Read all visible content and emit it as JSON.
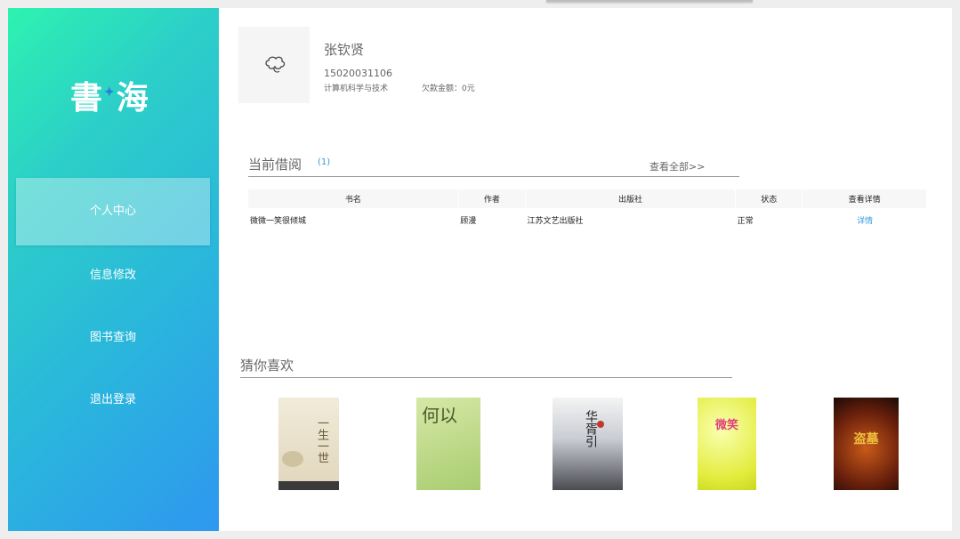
{
  "app": {
    "logo_chars": [
      "書",
      "海"
    ]
  },
  "sidebar": {
    "items": [
      {
        "label": "个人中心",
        "active": true
      },
      {
        "label": "信息修改",
        "active": false
      },
      {
        "label": "图书查询",
        "active": false
      },
      {
        "label": "退出登录",
        "active": false
      }
    ]
  },
  "profile": {
    "name": "张钦贤",
    "student_id": "15020031106",
    "major": "计算机科学与技术",
    "debt": "欠款金额：0元",
    "avatar_icon": "cloud-doodle-icon"
  },
  "borrow": {
    "title": "当前借阅",
    "count": "(1)",
    "view_all": "查看全部>>",
    "columns": [
      "书名",
      "作者",
      "出版社",
      "状态",
      "查看详情"
    ],
    "rows": [
      {
        "title": "微微一笑很倾城",
        "author": "顾漫",
        "publisher": "江苏文艺出版社",
        "status": "正常",
        "detail": "详情"
      }
    ]
  },
  "recommend": {
    "title": "猜你喜欢",
    "books": [
      {
        "cover_title": "一生一世",
        "cover_color": "#e8e0cc"
      },
      {
        "cover_title": "何以",
        "cover_color": "#bcd88a"
      },
      {
        "cover_title": "华胥引",
        "cover_color": "#9aa0a8"
      },
      {
        "cover_title": "微笑",
        "cover_color": "#e6ef4a"
      },
      {
        "cover_title": "盗墓",
        "cover_color": "#3a1a10"
      }
    ]
  },
  "colors": {
    "accent_link": "#3399dd",
    "sidebar_gradient_top": "#2df2b0",
    "sidebar_gradient_bottom": "#2f97f0"
  }
}
